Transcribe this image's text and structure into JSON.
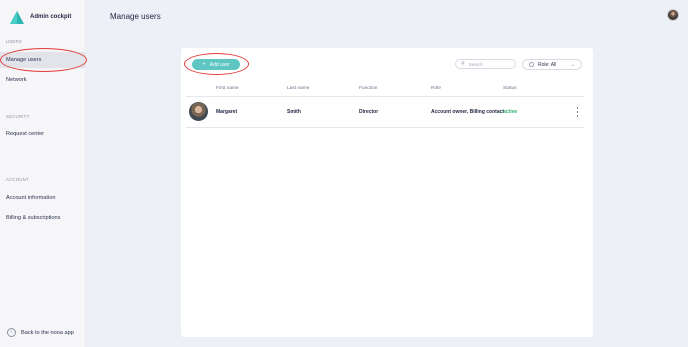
{
  "brand": {
    "name": "Admin cockpit",
    "logo_color": "#2cb5b0"
  },
  "sidebar": {
    "sections": [
      {
        "label": "USERS"
      },
      {
        "label": "SECURITY"
      },
      {
        "label": "ACCOUNT"
      }
    ],
    "items": [
      {
        "label": "Manage users"
      },
      {
        "label": "Network"
      },
      {
        "label": "Request center"
      },
      {
        "label": "Account information"
      },
      {
        "label": "Billing & subscriptions"
      }
    ],
    "back_label": "Back to the nooa app"
  },
  "header": {
    "title": "Manage users"
  },
  "toolbar": {
    "add_label": "Add user",
    "search_placeholder": "Search",
    "role_filter": "Role: All"
  },
  "table": {
    "columns": [
      "First name",
      "Last name",
      "Function",
      "Role",
      "Status"
    ],
    "rows": [
      {
        "first_name": "Margaret",
        "last_name": "Smith",
        "function": "Director",
        "role": "Account owner, Billing contact",
        "status": "active"
      }
    ]
  },
  "colors": {
    "accent": "#5dc6c2",
    "status_active": "#2fae6e",
    "highlight": "#e23b3b"
  }
}
